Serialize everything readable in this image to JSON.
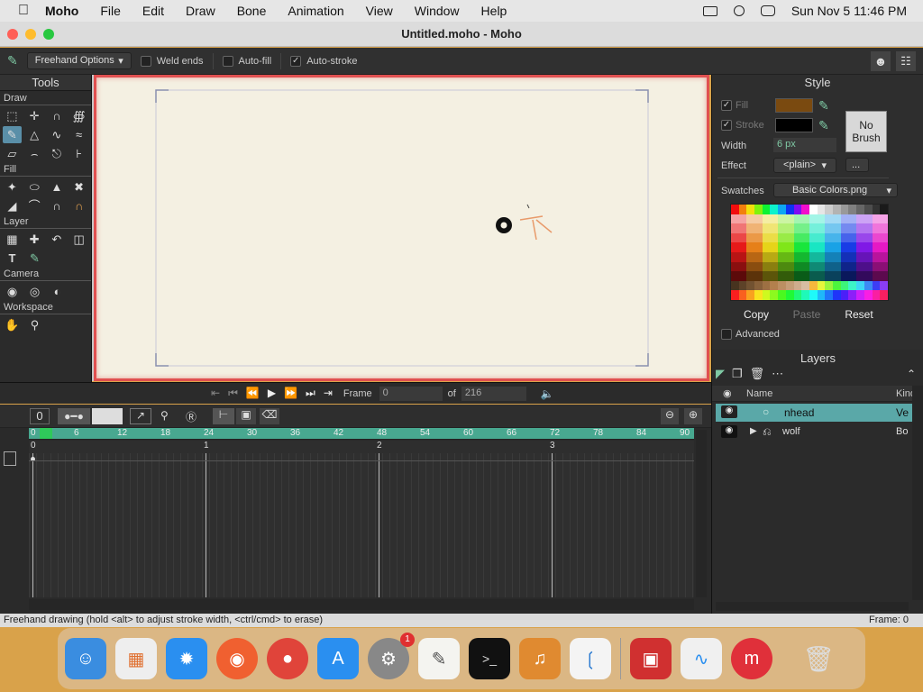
{
  "menubar": {
    "app": "Moho",
    "items": [
      "File",
      "Edit",
      "Draw",
      "Bone",
      "Animation",
      "View",
      "Window",
      "Help"
    ],
    "clock": "Sun Nov 5  11:46 PM"
  },
  "window": {
    "title": "Untitled.moho - Moho"
  },
  "options": {
    "tool_label": "Freehand Options",
    "weld_ends": "Weld ends",
    "auto_fill": "Auto-fill",
    "auto_stroke": "Auto-stroke"
  },
  "tools": {
    "title": "Tools",
    "sections": [
      "Draw",
      "Fill",
      "Layer",
      "Camera",
      "Workspace"
    ]
  },
  "style": {
    "title": "Style",
    "fill_label": "Fill",
    "stroke_label": "Stroke",
    "width_label": "Width",
    "width_value": "6 px",
    "effect_label": "Effect",
    "effect_value": "<plain>",
    "more_button": "...",
    "no_brush_line1": "No",
    "no_brush_line2": "Brush",
    "swatches_label": "Swatches",
    "swatches_value": "Basic Colors.png",
    "copy": "Copy",
    "paste": "Paste",
    "reset": "Reset",
    "advanced": "Advanced",
    "fill_color": "#7a4a10",
    "stroke_color": "#000000"
  },
  "layers": {
    "title": "Layers",
    "col_name": "Name",
    "col_kind": "Kind",
    "rows": [
      {
        "name": "nhead",
        "kind": "Ve"
      },
      {
        "name": "wolf",
        "kind": "Bo"
      }
    ]
  },
  "transport": {
    "frame_label": "Frame",
    "frame_value": "0",
    "of_label": "of",
    "total": "216"
  },
  "timeline": {
    "counter": "0",
    "ruler": [
      "0",
      "6",
      "12",
      "18",
      "24",
      "30",
      "36",
      "42",
      "48",
      "54",
      "60",
      "66",
      "72",
      "78",
      "84",
      "90"
    ],
    "seconds": [
      "0",
      "1",
      "2",
      "3"
    ]
  },
  "status": {
    "hint": "Freehand drawing (hold <alt> to adjust stroke width, <ctrl/cmd> to erase)",
    "frame": "Frame: 0"
  },
  "dock": {
    "badge": "1",
    "apps": [
      "Finder",
      "Launchpad",
      "Safari",
      "Firefox",
      "Chrome",
      "App Store",
      "System Settings",
      "TextEdit",
      "Terminal",
      "GarageBand",
      "VS Code",
      "Photo Booth",
      "Freeform",
      "Moho",
      "Trash"
    ]
  }
}
